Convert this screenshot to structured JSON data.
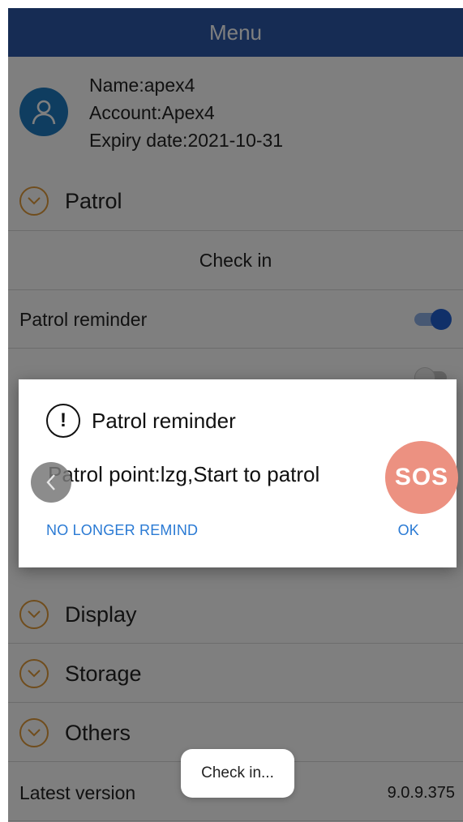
{
  "header": {
    "title": "Menu"
  },
  "profile": {
    "name": "Name:apex4",
    "account": "Account:Apex4",
    "expiry": "Expiry date:2021-10-31"
  },
  "sections": {
    "patrol": "Patrol",
    "display": "Display",
    "storage": "Storage",
    "others": "Others"
  },
  "patrol": {
    "check_in": "Check in",
    "reminder_label": "Patrol reminder",
    "reminder_enabled": true,
    "second_toggle_enabled": false
  },
  "latest_version": {
    "label": "Latest version",
    "value": "9.0.9.375"
  },
  "dialog": {
    "title": "Patrol reminder",
    "message": "Patrol point:lzg,Start to patrol",
    "no_longer_remind": "NO LONGER REMIND",
    "ok": "OK"
  },
  "floating": {
    "sos": "SOS"
  },
  "toast": {
    "text": "Check in..."
  },
  "colors": {
    "header": "#2c58a8",
    "accent_blue": "#2160d3",
    "chevron": "#e09a3a",
    "sos": "#ec9181",
    "dialog_button": "#2a7ad4"
  },
  "icons": {
    "avatar": "user-icon",
    "section": "chevron-down-circle-icon",
    "alert": "exclamation-circle-icon",
    "back": "chevron-left-icon"
  }
}
